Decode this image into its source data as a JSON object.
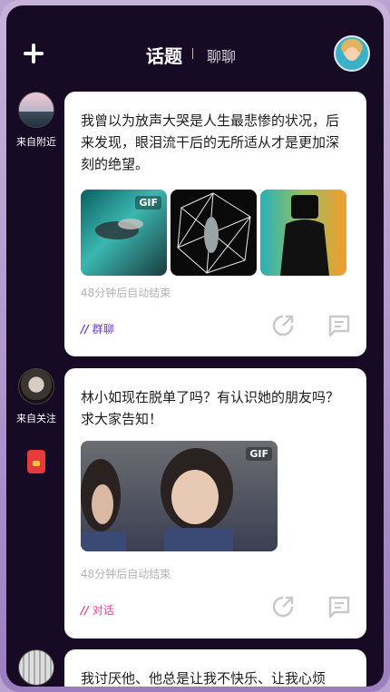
{
  "header": {
    "tab_main": "话题",
    "tab_secondary": "聊聊"
  },
  "sidebar": {
    "labels": [
      "来自附近",
      "来自关注"
    ]
  },
  "posts": [
    {
      "text": "我曾以为放声大哭是人生最悲惨的状况，后来发现，眼泪流干后的无所适从才是更加深刻的绝望。",
      "gif_label": "GIF",
      "expire": "48分钟后自动结束",
      "tag": "群聊",
      "tag_color": "#6a3fd0"
    },
    {
      "text": "林小如现在脱单了吗？有认识她的朋友吗？求大家告知！",
      "gif_label": "GIF",
      "expire": "48分钟后自动结束",
      "tag": "对话",
      "tag_color": "#e0429a"
    },
    {
      "text": "我讨厌他、他总是让我不快乐、让我心烦"
    }
  ],
  "icons": [
    "plus-icon",
    "share-icon",
    "comment-icon",
    "red-packet-icon"
  ]
}
